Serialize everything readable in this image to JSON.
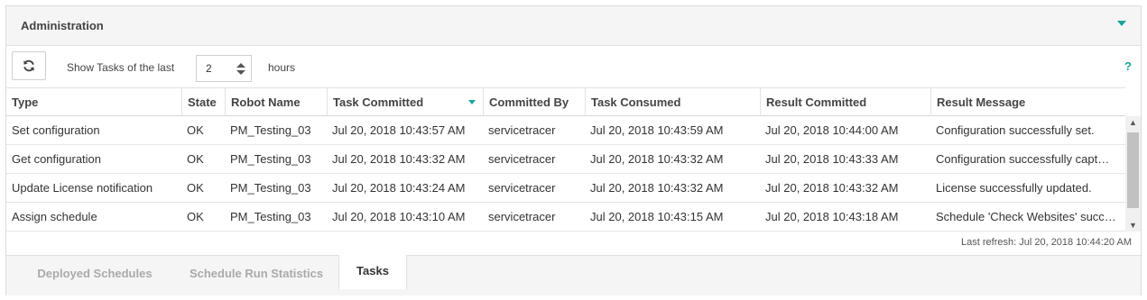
{
  "panel": {
    "title": "Administration"
  },
  "toolbar": {
    "refresh_icon": "refresh-icon",
    "show_label": "Show Tasks of the last",
    "hours_value": "2",
    "hours_unit": "hours",
    "help": "?"
  },
  "table": {
    "columns": [
      "Type",
      "State",
      "Robot Name",
      "Task Committed",
      "Committed By",
      "Task Consumed",
      "Result Committed",
      "Result Message"
    ],
    "sorted_column": "Task Committed",
    "sort_direction": "descending",
    "rows": [
      [
        "Set configuration",
        "OK",
        "PM_Testing_03",
        "Jul 20, 2018 10:43:57 AM",
        "servicetracer",
        "Jul 20, 2018 10:43:59 AM",
        "Jul 20, 2018 10:44:00 AM",
        "Configuration successfully set."
      ],
      [
        "Get configuration",
        "OK",
        "PM_Testing_03",
        "Jul 20, 2018 10:43:32 AM",
        "servicetracer",
        "Jul 20, 2018 10:43:32 AM",
        "Jul 20, 2018 10:43:33 AM",
        "Configuration successfully capt…"
      ],
      [
        "Update License notification",
        "OK",
        "PM_Testing_03",
        "Jul 20, 2018 10:43:24 AM",
        "servicetracer",
        "Jul 20, 2018 10:43:32 AM",
        "Jul 20, 2018 10:43:32 AM",
        "License successfully updated."
      ],
      [
        "Assign schedule",
        "OK",
        "PM_Testing_03",
        "Jul 20, 2018 10:43:10 AM",
        "servicetracer",
        "Jul 20, 2018 10:43:15 AM",
        "Jul 20, 2018 10:43:18 AM",
        "Schedule 'Check Websites' succ…"
      ]
    ]
  },
  "status": {
    "last_refresh": "Last refresh: Jul 20, 2018 10:44:20 AM"
  },
  "tabs": [
    {
      "label": "Deployed Schedules",
      "active": false
    },
    {
      "label": "Schedule Run Statistics",
      "active": false
    },
    {
      "label": "Tasks",
      "active": true
    }
  ],
  "colors": {
    "accent": "#1aa39a",
    "header_bg": "#f5f5f5",
    "border": "#e2e2e2"
  }
}
